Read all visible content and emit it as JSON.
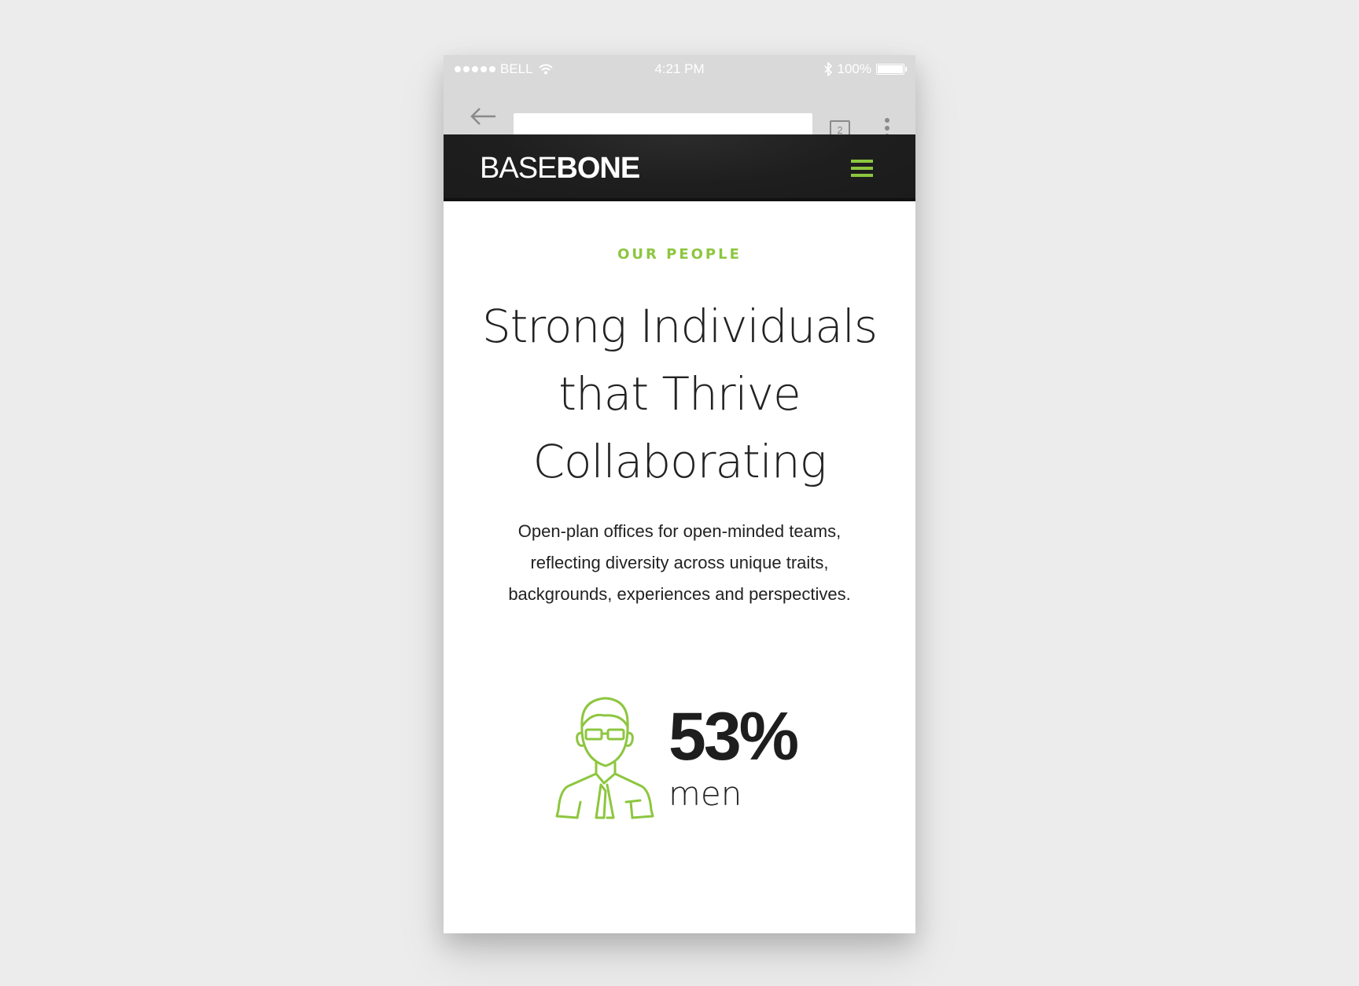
{
  "status_bar": {
    "carrier": "BELL",
    "time": "4:21 PM",
    "battery": "100%"
  },
  "browser": {
    "url_value": "",
    "tab_count": "2"
  },
  "site": {
    "logo_light": "BASE",
    "logo_bold": "BONE",
    "accent_color": "#8dc63f",
    "header_bg": "#1e1e1e"
  },
  "content": {
    "eyebrow": "OUR PEOPLE",
    "headline_lines": [
      "Strong Individuals",
      "that Thrive",
      "Collaborating"
    ],
    "lead_lines": [
      "Open-plan offices for open-minded teams,",
      "reflecting diversity across unique traits,",
      "backgrounds, experiences and perspectives."
    ]
  },
  "stat": {
    "value": "53%",
    "label": "men",
    "icon": "man-with-glasses-icon"
  }
}
